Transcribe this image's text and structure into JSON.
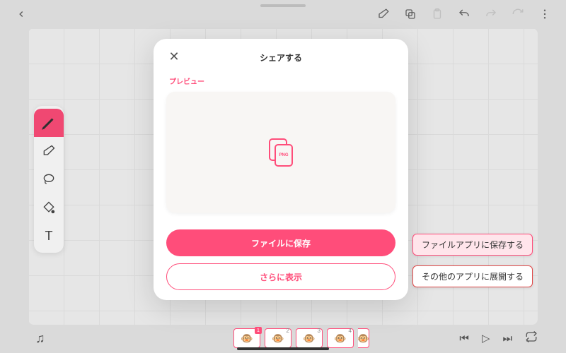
{
  "toolbar": {
    "back_icon": "chevron-left",
    "eraser_icon": "eraser",
    "copy_icon": "copy",
    "paste_icon": "paste",
    "undo_icon": "undo",
    "redo_icon": "redo",
    "forward_icon": "redo2",
    "more_icon": "more-vertical"
  },
  "tools": {
    "pen": "pen",
    "eraser": "eraser",
    "lasso": "lasso",
    "fill": "fill",
    "text_label": "T"
  },
  "modal": {
    "title": "シェアする",
    "close_label": "✕",
    "preview_label": "プレビュー",
    "png_badge": "PNG",
    "primary_label": "ファイルに保存",
    "secondary_label": "さらに表示"
  },
  "callouts": {
    "save_note": "ファイルアプリに保存する",
    "show_note": "その他のアプリに展開する"
  },
  "frames": {
    "items": [
      {
        "num": "1",
        "emoji": "🐵"
      },
      {
        "num": "2",
        "emoji": "🐵"
      },
      {
        "num": "3",
        "emoji": "🐵"
      },
      {
        "num": "4",
        "emoji": "🐵"
      }
    ],
    "partial_emoji": "🐵"
  },
  "playback": {
    "prev": "⏮",
    "play": "▷",
    "next": "⏭",
    "loop": "loop"
  },
  "bottom": {
    "music_icon": "♫"
  }
}
